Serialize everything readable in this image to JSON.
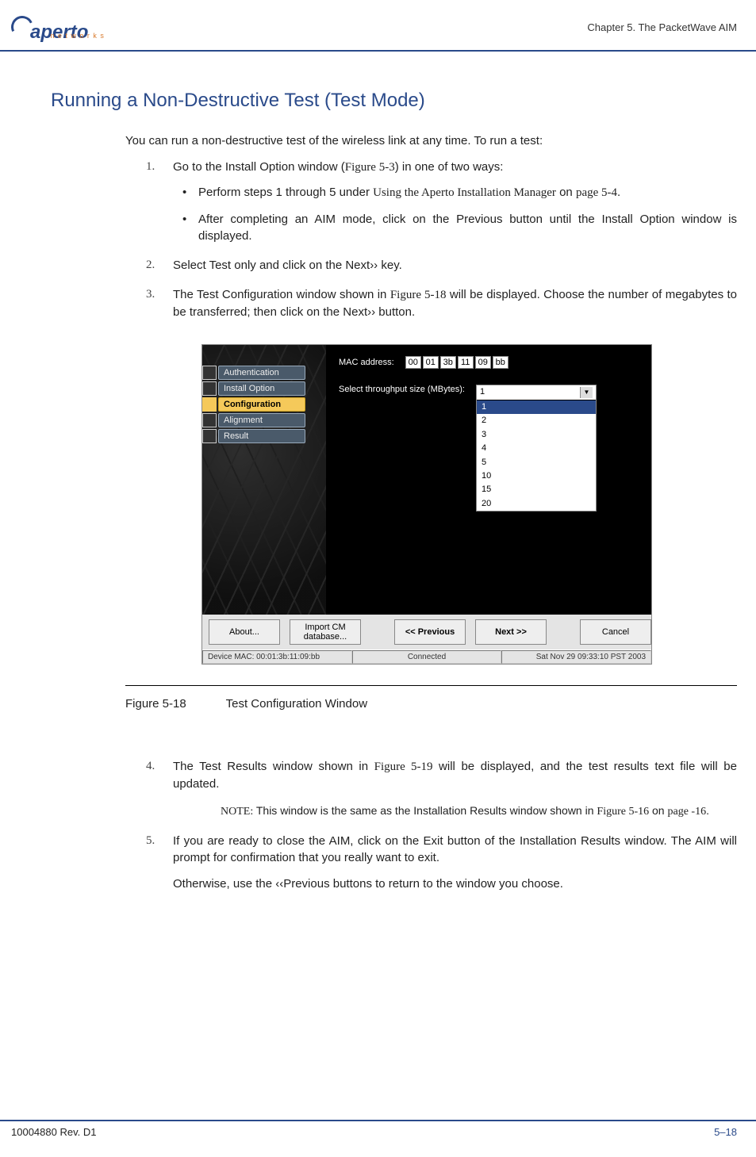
{
  "header": {
    "logo_text": "aperto",
    "logo_sub": "n e t w o r k s",
    "chapter": "Chapter 5.   The PacketWave AIM"
  },
  "section_title": "Running a Non-Destructive Test (Test Mode)",
  "intro": "You can run a non-destructive test of the wireless link at any time. To run a test:",
  "step1_lead": "Go to the Install Option window (",
  "step1_ref": "Figure 5-3",
  "step1_tail": ") in one of two ways:",
  "bullet1_a": "Perform steps 1 through 5 under ",
  "bullet1_ref": "Using the Aperto Installation Manager",
  "bullet1_b": " on ",
  "bullet1_page": "page 5-4",
  "bullet1_c": ".",
  "bullet2": "After completing an AIM mode, click on the Previous button until the Install Option window is displayed.",
  "step2": "Select Test only and click on the Next›› key.",
  "step3_a": "The Test Configuration window shown in ",
  "step3_ref": "Figure 5-18",
  "step3_b": " will be displayed. Choose the number of megabytes to be transferred; then click on the Next›› button.",
  "app": {
    "sidebar": [
      "Authentication",
      "Install Option",
      "Configuration",
      "Alignment",
      "Result"
    ],
    "sidebar_active_index": 2,
    "mac_label": "MAC address:",
    "mac_octets": [
      "00",
      "01",
      "3b",
      "11",
      "09",
      "bb"
    ],
    "throughput_label": "Select throughput size (MBytes):",
    "throughput_selected": "1",
    "throughput_options": [
      "1",
      "2",
      "3",
      "4",
      "5",
      "10",
      "15",
      "20"
    ],
    "buttons": {
      "about": "About...",
      "import": "Import CM database...",
      "prev": "<< Previous",
      "next": "Next >>",
      "cancel": "Cancel"
    },
    "status": {
      "mac": "Device MAC: 00:01:3b:11:09:bb",
      "conn": "Connected",
      "time": "Sat Nov 29 09:33:10 PST 2003"
    }
  },
  "fig_caption_num": "Figure 5-18",
  "fig_caption_title": "Test Configuration Window",
  "step4_a": "The Test Results window shown in ",
  "step4_ref": "Figure 5-19",
  "step4_b": " will be displayed, and the test results text file will be updated.",
  "note_lead": "NOTE:",
  "note_a": "  This window is the same as the Installation Results window shown in ",
  "note_ref": "Figure 5-16",
  "note_b": " on ",
  "note_page": "page -16",
  "note_c": ".",
  "step5_a": "If you are ready to close the AIM, click on the Exit button of the Installation Results window. The AIM will prompt for confirmation that you really want to exit.",
  "step5_b": "Otherwise, use the ‹‹Previous buttons to return to the window you choose.",
  "footer_left": "10004880 Rev. D1",
  "footer_right": "5–18"
}
